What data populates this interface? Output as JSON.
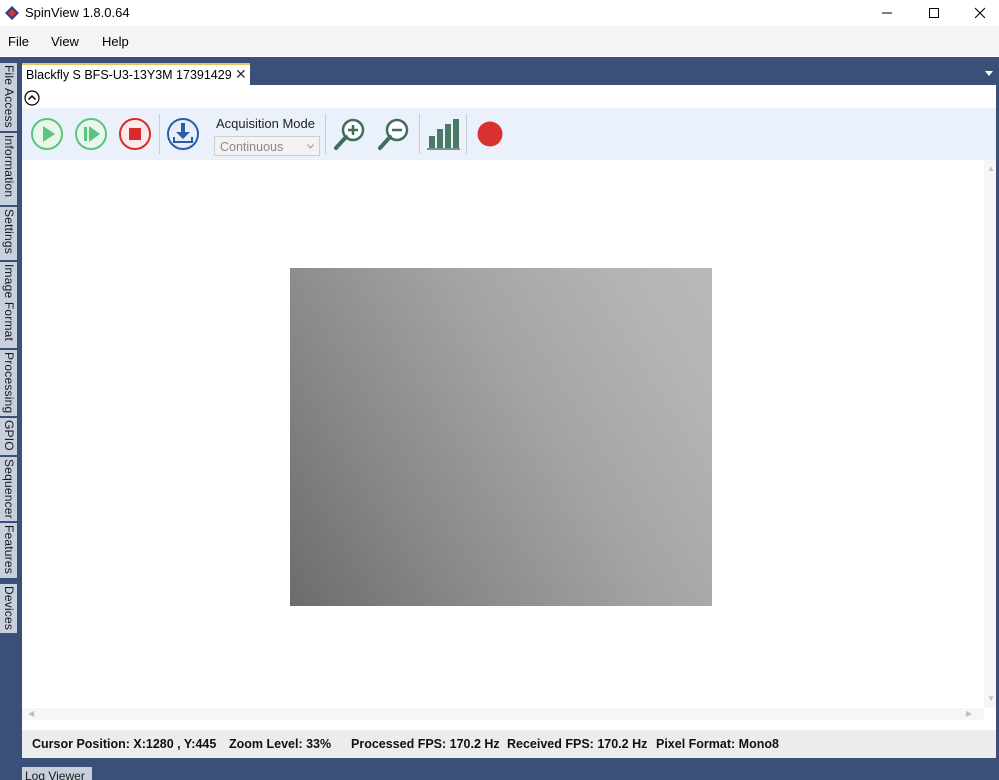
{
  "window": {
    "title": "SpinView 1.8.0.64"
  },
  "menu": {
    "file": "File",
    "view": "View",
    "help": "Help"
  },
  "side_tabs": [
    {
      "label": "File Access"
    },
    {
      "label": "Information"
    },
    {
      "label": "Settings"
    },
    {
      "label": "Image Format"
    },
    {
      "label": "Processing"
    },
    {
      "label": "GPIO"
    },
    {
      "label": "Sequencer"
    },
    {
      "label": "Features"
    },
    {
      "label": "Devices"
    }
  ],
  "doc_tab": {
    "label": "Blackfly S BFS-U3-13Y3M 17391429",
    "close_glyph": "✕"
  },
  "toolbar": {
    "acquisition_mode_label": "Acquisition Mode",
    "acquisition_mode_value": "Continuous"
  },
  "status": {
    "cursor": "Cursor Position: X:1280 , Y:445",
    "zoom": "Zoom Level: 33%",
    "processed_fps": "Processed FPS: 170.2 Hz",
    "received_fps": "Received FPS: 170.2 Hz",
    "pixel_format": "Pixel Format: Mono8"
  },
  "log_viewer": {
    "label": "Log Viewer"
  },
  "icons": {
    "play": "play-icon",
    "single_frame": "single-frame-icon",
    "stop": "stop-icon",
    "save": "save-download-icon",
    "zoom_in": "zoom-in-icon",
    "zoom_out": "zoom-out-icon",
    "histogram": "histogram-icon",
    "record": "record-icon"
  },
  "colors": {
    "frame": "#3b5078",
    "play_green": "#5cc47f",
    "stop_red": "#d92b2b",
    "save_blue": "#2a5ca8",
    "magnifier": "#3f6e5e",
    "histogram": "#4a7a65",
    "record_red": "#d93030"
  }
}
